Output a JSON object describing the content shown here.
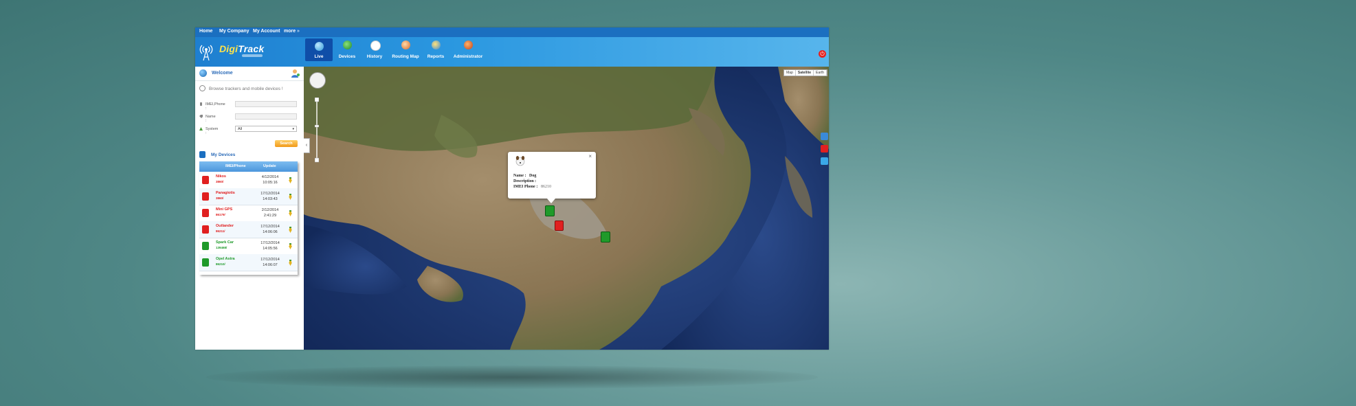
{
  "topnav": [
    "Home",
    "My Company",
    "My Account",
    "more"
  ],
  "topnav_more_arrow": "»",
  "logo": {
    "part1": "Digi",
    "part2": "Track"
  },
  "nav": [
    {
      "label": "Live",
      "icon": "globe-icon",
      "active": true
    },
    {
      "label": "Devices",
      "icon": "devices-icon",
      "active": false
    },
    {
      "label": "History",
      "icon": "clock-icon",
      "active": false
    },
    {
      "label": "Routing Map",
      "icon": "routing-map-icon",
      "active": false
    },
    {
      "label": "Reports",
      "icon": "reports-icon",
      "active": false
    },
    {
      "label": "Administrator",
      "icon": "administrator-icon",
      "active": false
    }
  ],
  "sidebar": {
    "welcome": "Welcome",
    "browse": "Browse trackers and mobile devices !",
    "filters": {
      "imei_label": "IMEI,Phone :",
      "name_label": "Name :",
      "system_label": "System :",
      "system_value": "All",
      "search_button": "Search"
    },
    "my_devices": "My Devices",
    "table": {
      "headers": [
        "IMEI/Phone",
        "Update"
      ],
      "rows": [
        {
          "name": "Nikos",
          "id": "3860/",
          "date": "4/12/2014",
          "time": "10:05:16",
          "color": "#e02020"
        },
        {
          "name": "Panagiotis",
          "id": "3860/",
          "date": "17/12/2014",
          "time": "14:03:43",
          "color": "#e02020"
        },
        {
          "name": "Mini GPS",
          "id": "86179/",
          "date": "2/12/2014",
          "time": "2:41:29",
          "color": "#e02020"
        },
        {
          "name": "Outlander",
          "id": "86211/",
          "date": "17/12/2014",
          "time": "14:06:06",
          "color": "#e02020"
        },
        {
          "name": "Spark Car",
          "id": "139468/",
          "date": "17/12/2014",
          "time": "14:05:56",
          "color": "#1f9a2a"
        },
        {
          "name": "Opel Astra",
          "id": "86210/",
          "date": "17/12/2014",
          "time": "14:06:07",
          "color": "#1f9a2a"
        }
      ]
    }
  },
  "map": {
    "types": [
      "Map",
      "Satellite",
      "Earth"
    ],
    "selected_type": "Satellite",
    "collapse_arrow": "‹",
    "popup": {
      "name_label": "Name :",
      "name_value": "Dog",
      "desc_label": "Description :",
      "imei_label": "IMEI Phone :",
      "imei_value": "86210",
      "close": "×"
    }
  },
  "colors": {
    "accent": "#1b6fc0",
    "active_nav": "#0f4ea8",
    "search": "#f19a1a",
    "red": "#e02020",
    "green": "#1f9a2a"
  }
}
